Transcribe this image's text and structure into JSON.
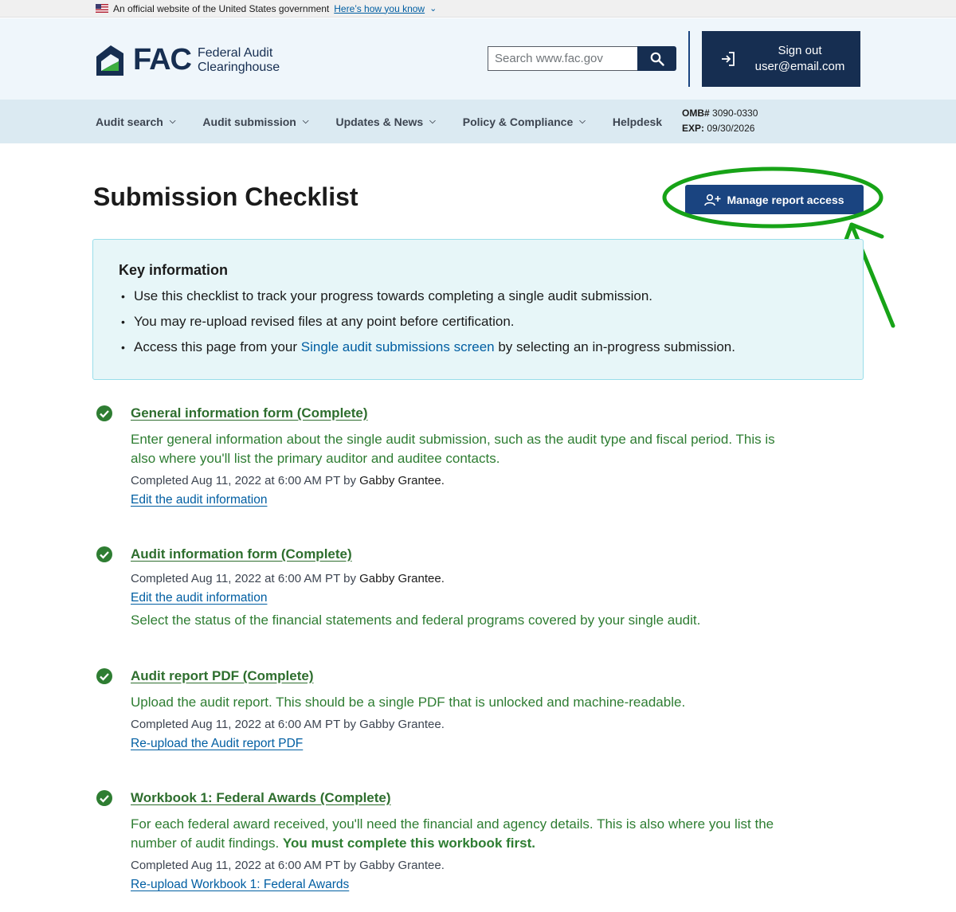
{
  "gov_banner": {
    "text": "An official website of the United States government",
    "link": "Here’s how you know"
  },
  "header": {
    "logo_abbr": "FAC",
    "logo_line1": "Federal Audit",
    "logo_line2": "Clearinghouse",
    "search_placeholder": "Search www.fac.gov",
    "signout_label": "Sign out",
    "signout_user": "user@email.com"
  },
  "nav": {
    "items": [
      {
        "label": "Audit search",
        "dropdown": true
      },
      {
        "label": "Audit submission",
        "dropdown": true
      },
      {
        "label": "Updates & News",
        "dropdown": true
      },
      {
        "label": "Policy & Compliance",
        "dropdown": true
      },
      {
        "label": "Helpdesk",
        "dropdown": false
      }
    ],
    "omb_label": "OMB#",
    "omb_value": "3090-0330",
    "exp_label": "EXP:",
    "exp_value": "09/30/2026"
  },
  "page": {
    "title": "Submission Checklist",
    "manage_button": "Manage report access"
  },
  "key_info": {
    "heading": "Key information",
    "item1": "Use this checklist to track your progress towards completing a single audit submission.",
    "item2": "You may re-upload revised files at any point before certification.",
    "item3_pre": "Access this page from your ",
    "item3_link": "Single audit submissions screen",
    "item3_post": " by selecting an in-progress submission."
  },
  "steps": [
    {
      "title": "General information form (Complete)",
      "desc_line1": "Enter general information about the single audit submission, such as the audit type and fiscal period. This is",
      "desc_line2": "also where you'll list the primary auditor and auditee contacts.",
      "meta": "Completed Aug 11, 2022 at 6:00 AM PT by",
      "who": "Gabby Grantee.",
      "link": "Edit the audit information"
    },
    {
      "title": "Audit information form (Complete)",
      "meta": "Completed Aug 11, 2022 at 6:00 AM PT by",
      "who": "Gabby Grantee.",
      "link": "Edit the audit information",
      "desc_line1": "Select the status of the financial statements and federal programs covered by your single audit."
    },
    {
      "title": "Audit report PDF (Complete)",
      "desc_line1": "Upload the audit report. This should be a single PDF that is unlocked and machine-readable.",
      "meta": "Completed Aug 11, 2022 at 6:00 AM PT by Gabby Grantee.",
      "link": "Re-upload the Audit report PDF"
    },
    {
      "title": "Workbook 1: Federal Awards (Complete)",
      "desc_line1": "For each federal award received, you'll need the financial and agency details. This is also where you list the",
      "desc_line2_pre": "number of audit findings. ",
      "desc_line2_bold": "You must complete this workbook first.",
      "meta": "Completed Aug 11, 2022 at 6:00 AM PT by Gabby Grantee.",
      "link": "Re-upload Workbook 1: Federal Awards"
    }
  ],
  "colors": {
    "navy": "#162e51",
    "button_blue": "#1a4480",
    "link_blue": "#005ea2",
    "success_green": "#2e7d32",
    "annotation_green": "#17a317",
    "info_bg": "#e7f6f8",
    "header_bg": "#eff6fb",
    "nav_bg": "#dbeaf2"
  }
}
